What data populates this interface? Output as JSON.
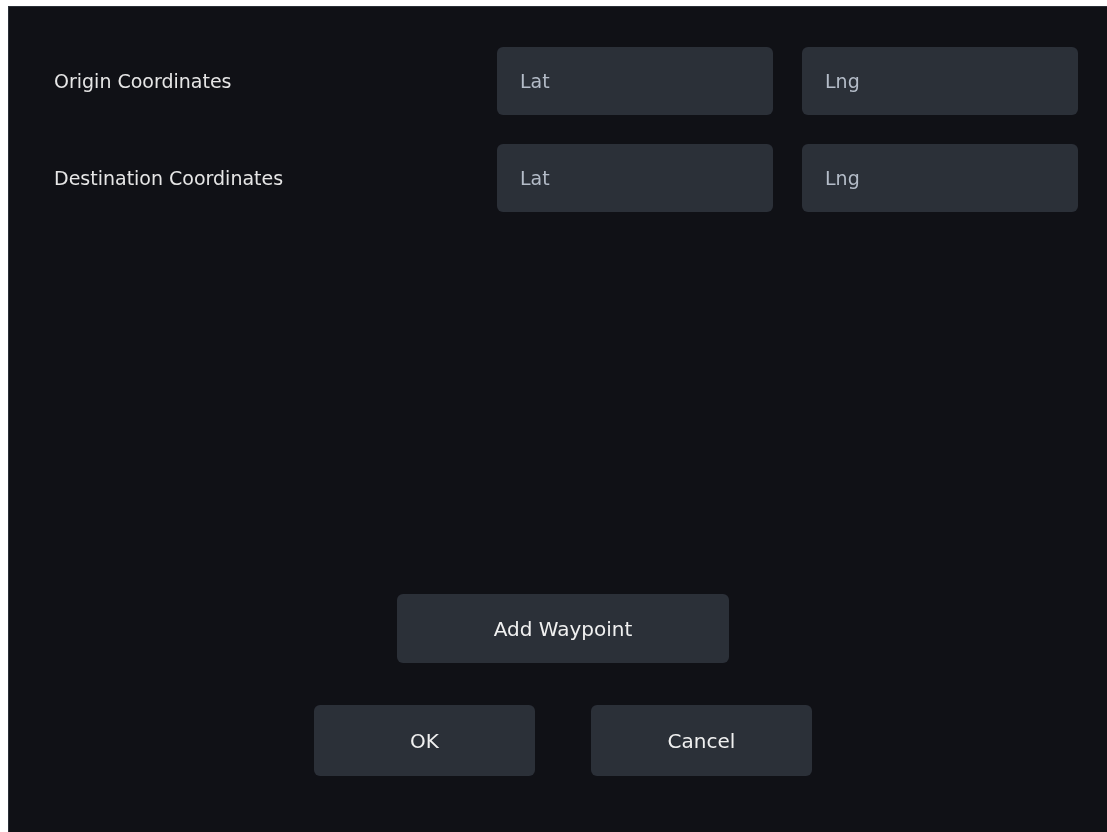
{
  "rows": [
    {
      "label": "Origin Coordinates",
      "inputs": [
        {
          "placeholder": "Lat"
        },
        {
          "placeholder": "Lng"
        }
      ]
    },
    {
      "label": "Destination Coordinates",
      "inputs": [
        {
          "placeholder": "Lat"
        },
        {
          "placeholder": "Lng"
        }
      ]
    }
  ],
  "add_button": "Add Waypoint",
  "buttons": [
    "OK",
    "Cancel"
  ]
}
